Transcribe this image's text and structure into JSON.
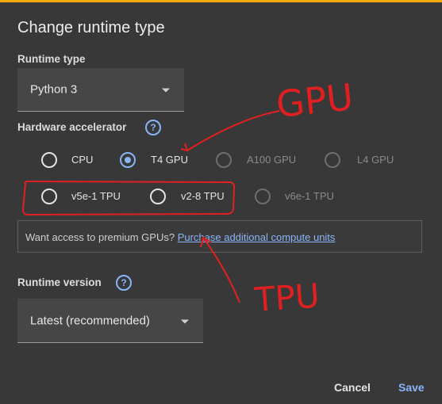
{
  "dialog": {
    "title": "Change runtime type"
  },
  "runtime_type": {
    "label": "Runtime type",
    "value": "Python 3"
  },
  "hardware_accelerator": {
    "label": "Hardware accelerator",
    "help": "?",
    "options": [
      {
        "label": "CPU",
        "checked": false,
        "enabled": true
      },
      {
        "label": "T4 GPU",
        "checked": true,
        "enabled": true
      },
      {
        "label": "A100 GPU",
        "checked": false,
        "enabled": false
      },
      {
        "label": "L4 GPU",
        "checked": false,
        "enabled": false
      },
      {
        "label": "v5e-1 TPU",
        "checked": false,
        "enabled": true
      },
      {
        "label": "v2-8 TPU",
        "checked": false,
        "enabled": true
      },
      {
        "label": "v6e-1 TPU",
        "checked": false,
        "enabled": false
      }
    ]
  },
  "premium_notice": {
    "text": "Want access to premium GPUs? ",
    "link": "Purchase additional compute units"
  },
  "runtime_version": {
    "label": "Runtime version",
    "help": "?",
    "value": "Latest (recommended)"
  },
  "footer": {
    "cancel_label": "Cancel",
    "save_label": "Save"
  },
  "annotations": {
    "gpu_text": "GPU",
    "tpu_text": "TPU",
    "color": "#e02020"
  },
  "colors": {
    "background": "#383838",
    "accent": "#8ab4f8",
    "top_bar": "#f9ab00"
  }
}
